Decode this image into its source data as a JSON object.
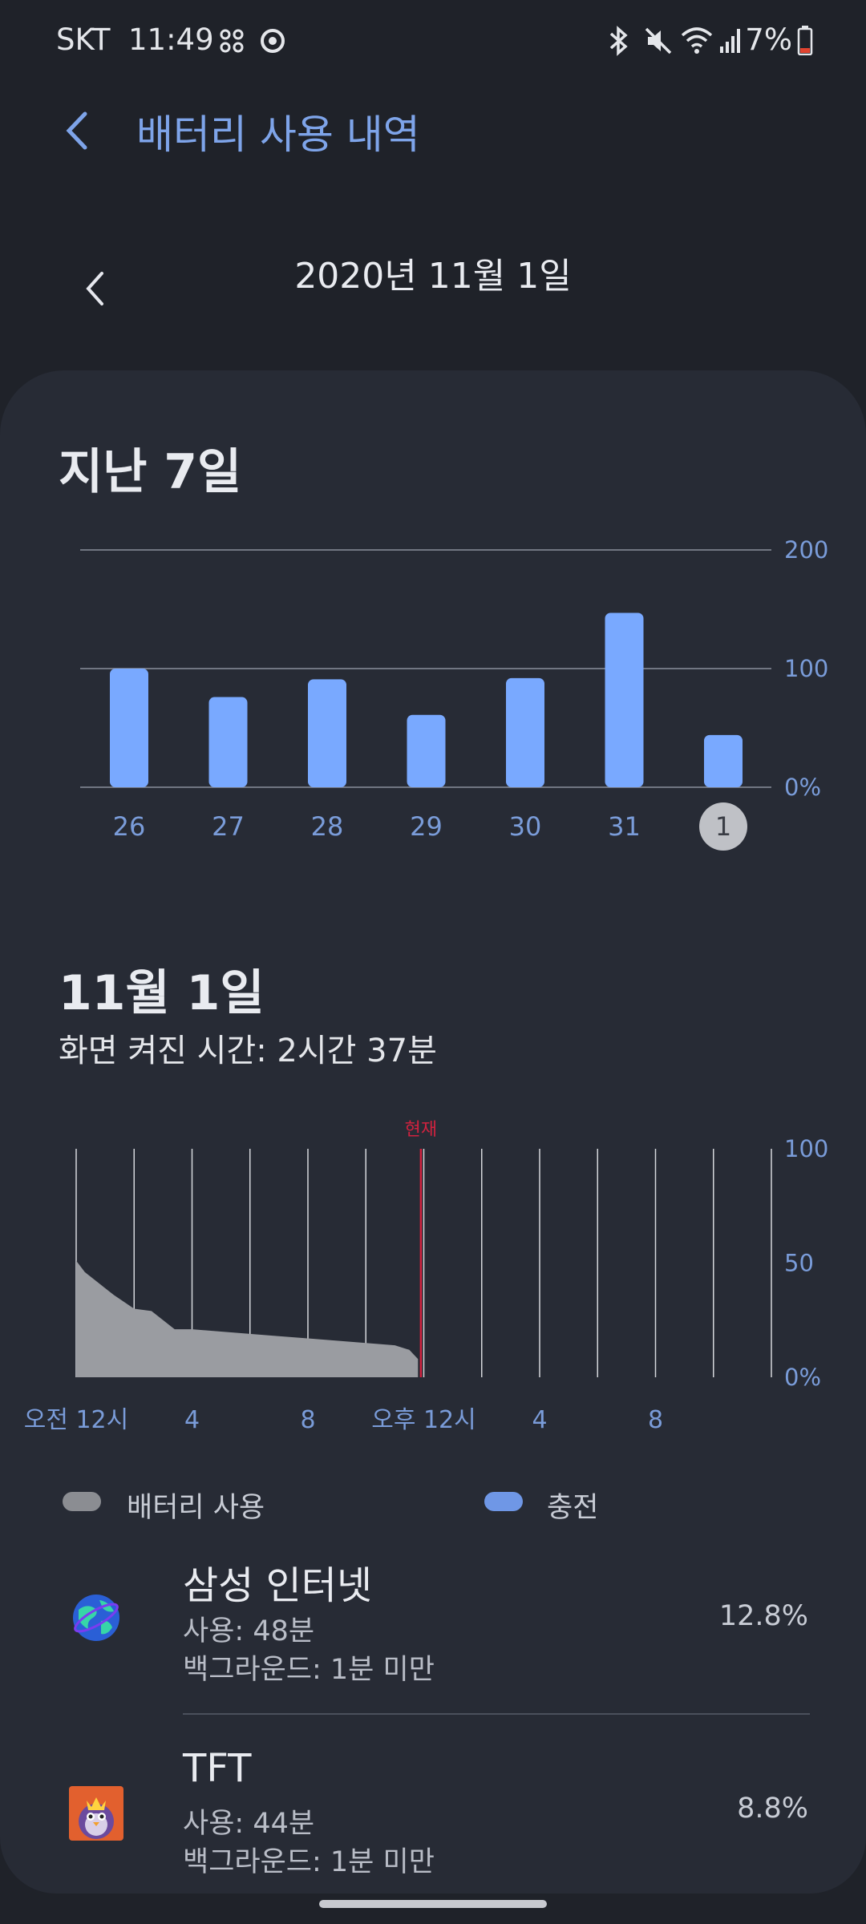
{
  "status_bar": {
    "carrier": "SKT",
    "time": "11:49",
    "battery": "7%",
    "icons": [
      "connection-icon",
      "sync-icon",
      "bluetooth-icon",
      "mute-icon",
      "wifi-icon",
      "signal-icon",
      "battery-icon"
    ]
  },
  "header": {
    "title": "배터리 사용 내역"
  },
  "date_nav": {
    "date": "2020년 11월 1일"
  },
  "week": {
    "title": "지난 7일",
    "chart_data": {
      "type": "bar",
      "categories": [
        "26",
        "27",
        "28",
        "29",
        "30",
        "31",
        "1"
      ],
      "values": [
        100,
        76,
        91,
        61,
        92,
        147,
        44
      ],
      "y_ticks": [
        "200",
        "100",
        "0%"
      ],
      "ylim": [
        0,
        200
      ],
      "selected": "1",
      "color": "#79a9ff"
    }
  },
  "day": {
    "title": "11월 1일",
    "screen_time": "화면 켜진 시간: 2시간 37분",
    "now_label": "현재",
    "chart_data": {
      "type": "area",
      "series": [
        {
          "name": "배터리 사용",
          "x_hours": [
            0,
            0.3,
            0.8,
            1.3,
            2.0,
            2.6,
            3.0,
            3.4,
            4.0,
            5.0,
            6.0,
            7.0,
            8.0,
            9.0,
            10.0,
            11.0,
            11.5,
            11.8
          ],
          "values": [
            51,
            46,
            41,
            36,
            30,
            29,
            25,
            21,
            21,
            20,
            19,
            18,
            17,
            16,
            15,
            14,
            12,
            8
          ]
        }
      ],
      "x_tick_labels": [
        "오전 12시",
        "4",
        "8",
        "오후 12시",
        "4",
        "8"
      ],
      "y_ticks": [
        "100",
        "50",
        "0%"
      ],
      "ylim": [
        0,
        100
      ],
      "xlim": [
        0,
        24
      ],
      "now_hour": 11.9,
      "fill_color": "#9a9ca1",
      "now_color": "#d1223f"
    }
  },
  "legend": {
    "usage_label": "배터리 사용",
    "charging_label": "충전",
    "usage_color": "#8b8d92",
    "charging_color": "#6f97e6"
  },
  "apps": [
    {
      "name": "삼성 인터넷",
      "usage": "사용: 48분",
      "background": "백그라운드: 1분 미만",
      "percent": "12.8%",
      "icon": "samsung-internet-icon"
    },
    {
      "name": "TFT",
      "usage": "사용: 44분",
      "background": "백그라운드: 1분 미만",
      "percent": "8.8%",
      "icon": "tft-icon"
    }
  ]
}
